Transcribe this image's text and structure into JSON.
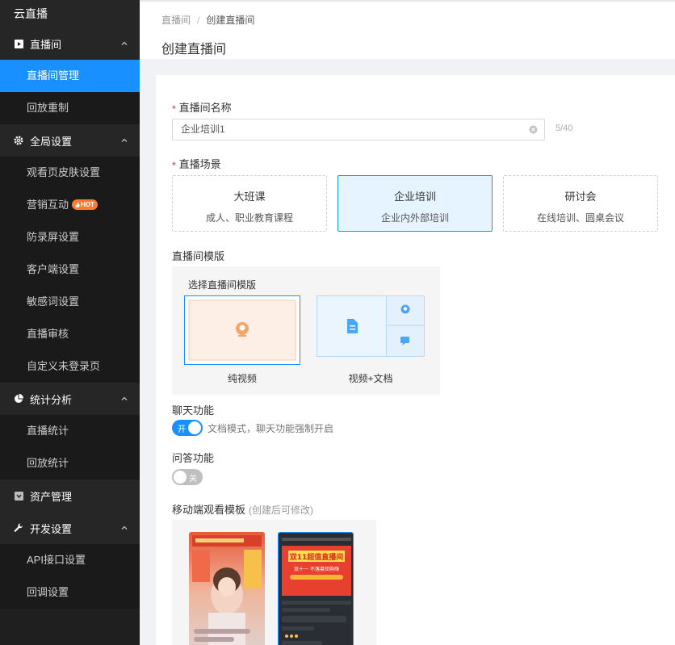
{
  "sidebar": {
    "brand": "云直播",
    "groups": [
      {
        "label": "直播间",
        "icon": "play-square-icon",
        "items": [
          "直播间管理",
          "回放重制"
        ]
      },
      {
        "label": "全局设置",
        "icon": "gear-icon",
        "items": [
          "观看页皮肤设置",
          "营销互动",
          "防录屏设置",
          "客户端设置",
          "敏感词设置",
          "直播审核",
          "自定义未登录页"
        ]
      },
      {
        "label": "统计分析",
        "icon": "pie-chart-icon",
        "items": [
          "直播统计",
          "回放统计"
        ]
      },
      {
        "label": "资产管理",
        "icon": "asset-icon"
      },
      {
        "label": "开发设置",
        "icon": "wrench-icon",
        "items": [
          "API接口设置",
          "回调设置"
        ]
      }
    ],
    "hot_badge": "HOT",
    "active_item": "直播间管理"
  },
  "header": {
    "breadcrumb": [
      "直播间",
      "创建直播间"
    ],
    "breadcrumb_sep": "/",
    "title": "创建直播间"
  },
  "form": {
    "name_label": "直播间名称",
    "name_value": "企业培训1",
    "name_counter": "5/40",
    "scene_label": "直播场景",
    "scenes": [
      {
        "title": "大班课",
        "desc": "成人、职业教育课程"
      },
      {
        "title": "企业培训",
        "desc": "企业内外部培训"
      },
      {
        "title": "研讨会",
        "desc": "在线培训、圆桌会议"
      }
    ],
    "selected_scene": 1,
    "template_label": "直播间模版",
    "template_sub": "选择直播间模版",
    "templates": [
      "纯视频",
      "视频+文档"
    ],
    "selected_template": 0,
    "chat_label": "聊天功能",
    "chat_toggle": "开",
    "chat_hint": "文档模式，聊天功能强制开启",
    "qa_label": "问答功能",
    "qa_toggle": "关",
    "mobile_label": "移动端观看模板",
    "mobile_note": "(创建后可修改)",
    "mobile_preview2_text": "双11超值直播间",
    "mobile_preview2_sub": "双十一 不落幕钜购嗨"
  },
  "colors": {
    "primary": "#1890ff",
    "sidebar_bg": "#1f1f1f",
    "hot": "#ff7a2b",
    "required": "#f5222d"
  }
}
